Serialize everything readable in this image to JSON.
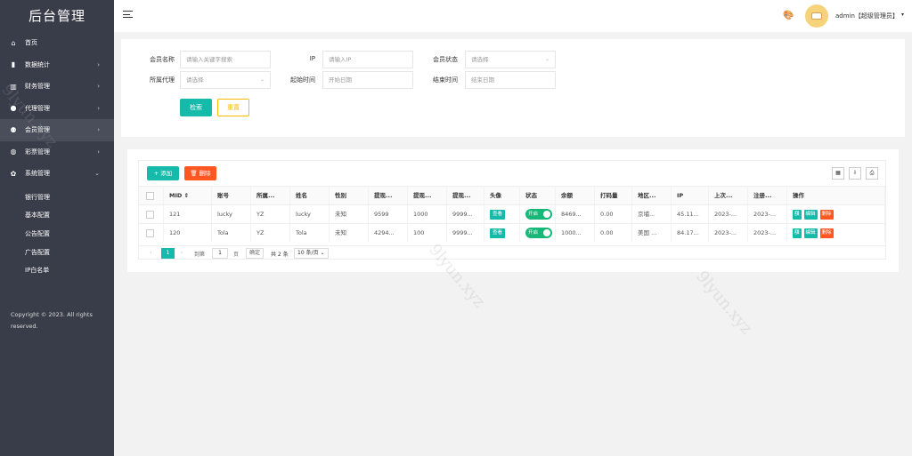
{
  "sidebar": {
    "logo": "后台管理",
    "items": [
      {
        "label": "首页",
        "icon": "home-icon",
        "chevron": ""
      },
      {
        "label": "数据统计",
        "icon": "bar-chart-icon",
        "chevron": "›"
      },
      {
        "label": "财务管理",
        "icon": "bank-icon",
        "chevron": "›"
      },
      {
        "label": "代理管理",
        "icon": "user-icon",
        "chevron": "›"
      },
      {
        "label": "会员管理",
        "icon": "users-icon",
        "chevron": "›"
      },
      {
        "label": "彩票管理",
        "icon": "gamepad-icon",
        "chevron": "›"
      },
      {
        "label": "系统管理",
        "icon": "gear-icon",
        "chevron": "⌄"
      }
    ],
    "subitems": [
      "银行管理",
      "基本配置",
      "公告配置",
      "广告配置",
      "IP白名单"
    ],
    "copyright": "Copyright © 2023. All rights reserved."
  },
  "header": {
    "user": "admin【超级管理员】",
    "caret": "▾"
  },
  "filters": {
    "member_name": {
      "label": "会员名称",
      "placeholder": "请输入关键字搜索"
    },
    "ip": {
      "label": "IP",
      "placeholder": "请输入IP"
    },
    "member_status": {
      "label": "会员状态",
      "placeholder": "请选择"
    },
    "agent": {
      "label": "所属代理",
      "placeholder": "请选择"
    },
    "start_time": {
      "label": "起始时间",
      "placeholder": "开始日期"
    },
    "end_time": {
      "label": "结束时间",
      "placeholder": "结束日期"
    },
    "search_label": "检索",
    "reset_label": "重置"
  },
  "table": {
    "add_label": "+ 添加",
    "delete_label": "🗑 删除",
    "columns": [
      "MID",
      "账号",
      "所属...",
      "姓名",
      "性别",
      "提现...",
      "提现...",
      "提现...",
      "头像",
      "状态",
      "余额",
      "打码量",
      "地区...",
      "IP",
      "上次...",
      "注册...",
      "操作"
    ],
    "sort_icon": "⇕",
    "view_label": "查看",
    "switch_label": "开启",
    "rows": [
      {
        "mid": "121",
        "account": "lucky",
        "agent": "YZ",
        "name": "lucky",
        "gender": "未知",
        "w1": "9599",
        "w2": "1000",
        "w3": "9999...",
        "balance": "8469...",
        "bet": "0.00",
        "region": "京埔...",
        "ip": "45.11...",
        "last": "2023-...",
        "reg": "2023-..."
      },
      {
        "mid": "120",
        "account": "Tola",
        "agent": "YZ",
        "name": "Tola",
        "gender": "未知",
        "w1": "4294...",
        "w2": "100",
        "w3": "9999...",
        "balance": "1000...",
        "bet": "0.00",
        "region": "美国 ...",
        "ip": "84.17...",
        "last": "2023-...",
        "reg": "2023-..."
      }
    ],
    "ops": [
      "額",
      "编辑",
      "删除"
    ]
  },
  "pager": {
    "prev": "‹",
    "current": "1",
    "next": "›",
    "goto": "到第",
    "page_input": "1",
    "page_unit": "页",
    "confirm": "确定",
    "total": "共 2 条",
    "per_page": "10 条/页 ⌄"
  }
}
